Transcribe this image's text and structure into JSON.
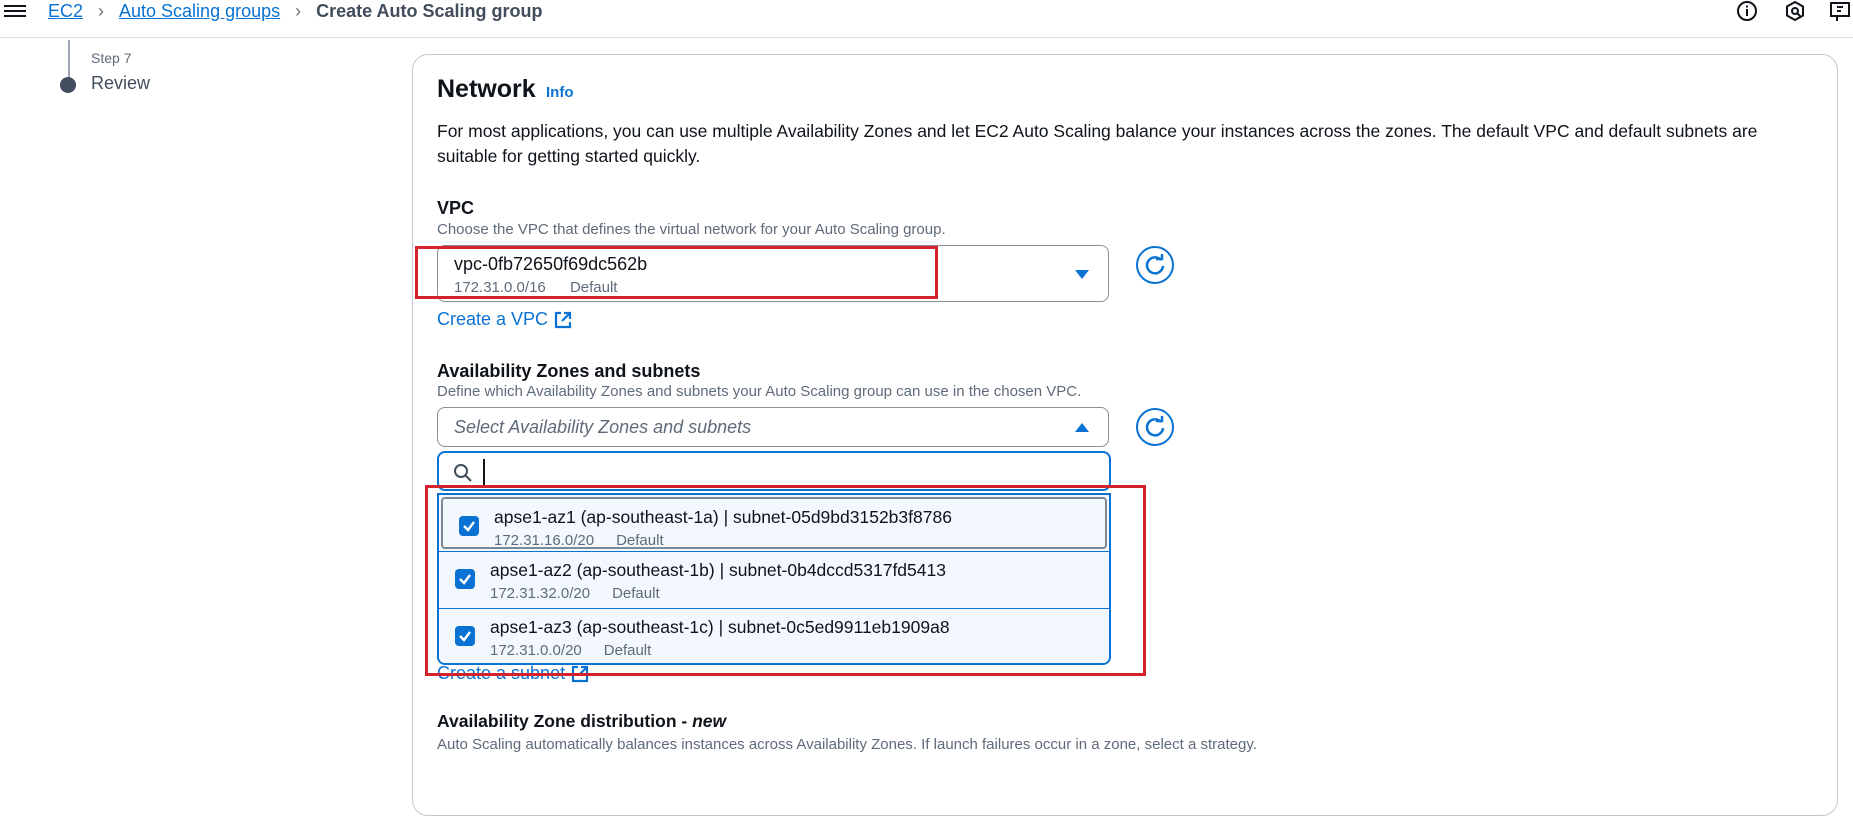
{
  "breadcrumb": {
    "items": [
      "EC2",
      "Auto Scaling groups"
    ],
    "current": "Create Auto Scaling group"
  },
  "stepper": {
    "step_label": "Step 7",
    "step_name": "Review"
  },
  "network": {
    "title": "Network",
    "info_link": "Info",
    "description": "For most applications, you can use multiple Availability Zones and let EC2 Auto Scaling balance your instances across the zones. The default VPC and default subnets are suitable for getting started quickly."
  },
  "vpc": {
    "label": "VPC",
    "hint": "Choose the VPC that defines the virtual network for your Auto Scaling group.",
    "selected_id": "vpc-0fb72650f69dc562b",
    "selected_cidr": "172.31.0.0/16",
    "selected_tag": "Default",
    "create_link": "Create a VPC"
  },
  "az": {
    "label": "Availability Zones and subnets",
    "hint": "Define which Availability Zones and subnets your Auto Scaling group can use in the chosen VPC.",
    "placeholder": "Select Availability Zones and subnets",
    "search_value": "",
    "options": [
      {
        "title": "apse1-az1 (ap-southeast-1a) | subnet-05d9bd3152b3f8786",
        "cidr": "172.31.16.0/20",
        "tag": "Default",
        "checked": true
      },
      {
        "title": "apse1-az2 (ap-southeast-1b) | subnet-0b4dccd5317fd5413",
        "cidr": "172.31.32.0/20",
        "tag": "Default",
        "checked": true
      },
      {
        "title": "apse1-az3 (ap-southeast-1c) | subnet-0c5ed9911eb1909a8",
        "cidr": "172.31.0.0/20",
        "tag": "Default",
        "checked": true
      }
    ],
    "create_subnet_link": "Create a subnet"
  },
  "az_distribution": {
    "title": "Availability Zone distribution - ",
    "title_new": "new",
    "hint": "Auto Scaling automatically balances instances across Availability Zones. If launch failures occur in a zone, select a strategy."
  },
  "colors": {
    "link": "#0972d3",
    "highlight_box": "#d5232e",
    "option_bg": "#f2f8fd"
  }
}
